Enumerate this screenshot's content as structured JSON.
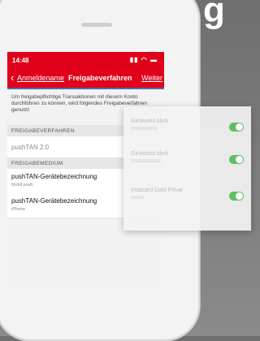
{
  "background": {
    "text": "g"
  },
  "status": {
    "time": "14:48",
    "icons": "▮▮ ◠ ▬"
  },
  "nav": {
    "back_label": "Anmeldename",
    "title": "Freigabeverfahren",
    "next_label": "Weiter"
  },
  "intro": "Um freigabepflichtige Transaktionen mit diesem Konto durchführen zu können, wird folgendes Freigabeverfahren genutzt:",
  "section_verfahren": "FREIGABEVERFAHREN",
  "verfahren_value": "pushTAN 2.0",
  "section_medium": "FREIGABEMEDIUM",
  "devices": [
    {
      "name": "pushTAN-Gerätebezeichnung",
      "type": "Mobil push"
    },
    {
      "name": "pushTAN-Gerätebezeichnung",
      "type": "iPhone"
    }
  ],
  "accounts": [
    {
      "name": "Girokonto.klick",
      "number": "XXXXXXXXXX",
      "enabled": true
    },
    {
      "name": "Girokonto.klick",
      "number": "XXXXXXXXXXX",
      "enabled": true
    },
    {
      "name": "Visacard Gold Privat",
      "number": "XXXXX",
      "enabled": true
    }
  ],
  "colors": {
    "accent": "#e1001a",
    "toggle_on": "#5fbf62"
  }
}
